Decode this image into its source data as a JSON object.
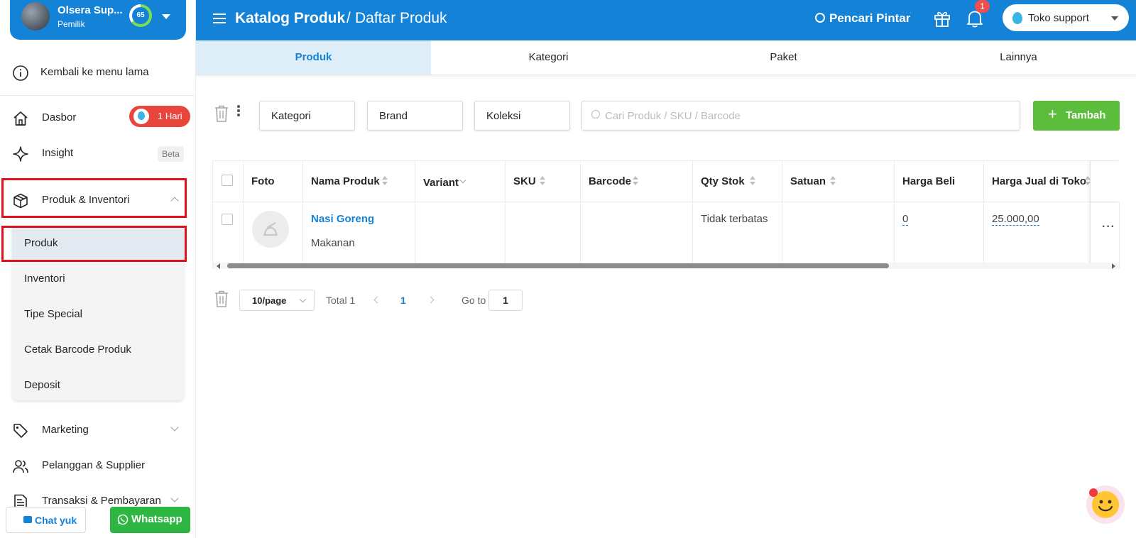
{
  "profile": {
    "name": "Olsera Sup...",
    "role": "Pemilik",
    "score": "65"
  },
  "sidebar": {
    "back_label": "Kembali ke menu lama",
    "dasbor": {
      "label": "Dasbor",
      "badge": "1 Hari"
    },
    "insight": {
      "label": "Insight",
      "badge": "Beta"
    },
    "produk_inventori": {
      "label": "Produk & Inventori",
      "items": [
        {
          "label": "Produk"
        },
        {
          "label": "Inventori"
        },
        {
          "label": "Tipe Special"
        },
        {
          "label": "Cetak Barcode Produk"
        },
        {
          "label": "Deposit"
        }
      ]
    },
    "marketing": {
      "label": "Marketing"
    },
    "pelanggan": {
      "label": "Pelanggan & Supplier"
    },
    "transaksi": {
      "label": "Transaksi & Pembayaran"
    }
  },
  "footer_buttons": {
    "chat": "Chat yuk",
    "whatsapp": "Whatsapp"
  },
  "header": {
    "title": "Katalog Produk",
    "separator": "/",
    "subtitle": "Daftar Produk",
    "smart_search": "Pencari Pintar",
    "notification_count": "1",
    "store": "Toko support"
  },
  "tabs": [
    {
      "label": "Produk",
      "active": true
    },
    {
      "label": "Kategori",
      "active": false
    },
    {
      "label": "Paket",
      "active": false
    },
    {
      "label": "Lainnya",
      "active": false
    }
  ],
  "toolbar": {
    "filters": [
      "Kategori",
      "Brand",
      "Koleksi"
    ],
    "search_placeholder": "Cari Produk / SKU / Barcode",
    "add_label": "Tambah"
  },
  "table": {
    "headers": [
      "Foto",
      "Nama Produk",
      "Variant",
      "SKU",
      "Barcode",
      "Qty Stok",
      "Satuan",
      "Harga Beli",
      "Harga Jual di Toko"
    ],
    "rows": [
      {
        "name": "Nasi Goreng",
        "category": "Makanan",
        "variant": "",
        "sku": "",
        "barcode": "",
        "qty": "Tidak terbatas",
        "satuan": "",
        "harga_beli": "0",
        "harga_jual": "25.000,00"
      }
    ]
  },
  "pagination": {
    "page_size": "10/page",
    "total": "Total 1",
    "current_page": "1",
    "goto_label": "Go to",
    "goto_value": "1"
  },
  "colors": {
    "primary": "#1482d7",
    "add_button": "#5cbd3c",
    "badge_red": "#e8453c",
    "highlight_border": "#e3101b",
    "whatsapp": "#2db742"
  }
}
